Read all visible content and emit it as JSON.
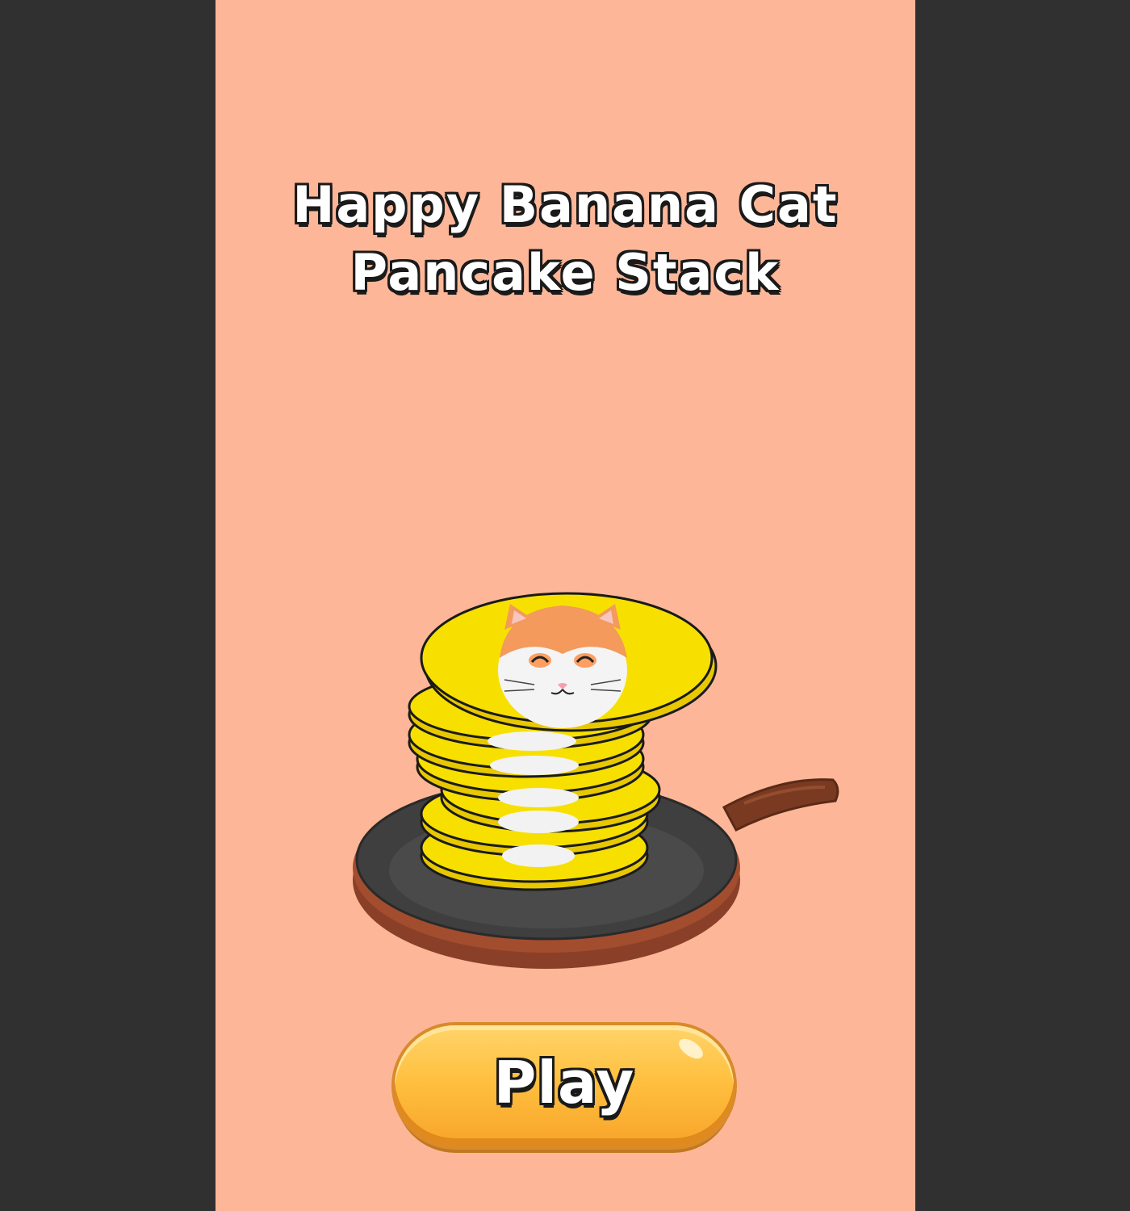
{
  "title": {
    "line1": "Happy Banana Cat",
    "line2": "Pancake Stack"
  },
  "play_button": {
    "label": "Play"
  },
  "colors": {
    "background": "#fdb798",
    "side_bars": "#303030",
    "pancake": "#f7e000",
    "pan": "#3f3f3f",
    "pan_rim": "#8a4028",
    "button": "#ffc040"
  },
  "icons": [
    "cat-face-icon",
    "frying-pan-icon",
    "pancake-stack-icon"
  ]
}
